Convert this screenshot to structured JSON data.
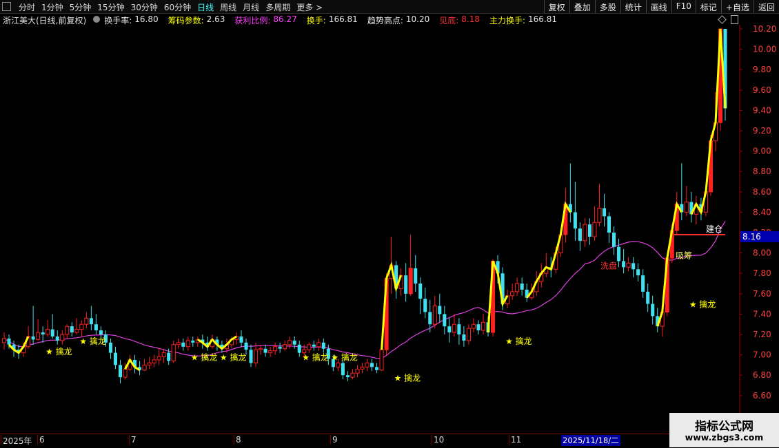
{
  "toolbar": {
    "periods": [
      "分时",
      "1分钟",
      "5分钟",
      "15分钟",
      "30分钟",
      "60分钟",
      "日线",
      "周线",
      "月线",
      "多周期",
      "更多 >"
    ],
    "active_period": "日线",
    "buttons": [
      "复权",
      "叠加",
      "多股",
      "统计",
      "画线",
      "F10",
      "标记",
      "+自选",
      "返回"
    ]
  },
  "info": {
    "title": "浙江美大(日线,前复权)",
    "turnover_label": "换手率:",
    "turnover_value": "16.80",
    "chip_label": "筹码参数:",
    "chip_value": "2.63",
    "profit_label": "获利比例:",
    "profit_value": "86.27",
    "hs_label": "换手:",
    "hs_value": "166.81",
    "trend_label": "趋势高点:",
    "trend_value": "10.20",
    "bottom_label": "见底:",
    "bottom_value": "8.18",
    "main_label": "主力换手:",
    "main_value": "166.81"
  },
  "axis": {
    "price_labels": [
      "10.20",
      "10.00",
      "9.80",
      "9.60",
      "9.40",
      "9.20",
      "9.00",
      "8.80",
      "8.60",
      "8.40",
      "8.20",
      "8.00",
      "7.80",
      "7.60",
      "7.40",
      "7.20",
      "7.00",
      "6.80",
      "6.60"
    ],
    "current_price": "8.16"
  },
  "dates": {
    "ticks": [
      "2025年",
      "6",
      "7",
      "8",
      "9",
      "10",
      "11"
    ],
    "cursor": "2025/11/18/二"
  },
  "signals": {
    "star_label": "★ 擒龙",
    "build": "建仓",
    "absorb": "吸筹",
    "wash": "洗盘"
  },
  "watermark": {
    "line1": "指标公式网",
    "line2": "www.zbgs3.com"
  },
  "colors": {
    "up": "#ff2020",
    "down": "#40e0f0",
    "ma": "#e040e0",
    "signal": "#ffff00"
  },
  "chart_data": {
    "type": "candlestick",
    "ylim": [
      6.5,
      10.3
    ],
    "candles": [
      [
        7.12,
        7.16,
        7.22,
        7.05
      ],
      [
        7.16,
        7.1,
        7.2,
        7.06
      ],
      [
        7.1,
        7.05,
        7.14,
        6.98
      ],
      [
        7.05,
        7.02,
        7.1,
        6.96
      ],
      [
        7.02,
        7.08,
        7.12,
        6.98
      ],
      [
        7.08,
        7.18,
        7.28,
        7.06
      ],
      [
        7.18,
        7.15,
        7.48,
        7.1
      ],
      [
        7.15,
        7.22,
        7.35,
        7.14
      ],
      [
        7.22,
        7.2,
        7.28,
        7.12
      ],
      [
        7.2,
        7.25,
        7.34,
        7.18
      ],
      [
        7.25,
        7.18,
        7.4,
        7.16
      ],
      [
        7.18,
        7.14,
        7.24,
        7.1
      ],
      [
        7.14,
        7.2,
        7.24,
        7.1
      ],
      [
        7.2,
        7.28,
        7.3,
        7.16
      ],
      [
        7.28,
        7.22,
        7.32,
        7.18
      ],
      [
        7.22,
        7.25,
        7.36,
        7.2
      ],
      [
        7.25,
        7.3,
        7.34,
        7.18
      ],
      [
        7.3,
        7.36,
        7.42,
        7.26
      ],
      [
        7.36,
        7.3,
        7.48,
        7.24
      ],
      [
        7.3,
        7.24,
        7.4,
        7.2
      ],
      [
        7.24,
        7.2,
        7.28,
        7.16
      ],
      [
        7.2,
        7.12,
        7.24,
        7.08
      ],
      [
        7.12,
        7.02,
        7.16,
        6.96
      ],
      [
        7.02,
        6.9,
        7.08,
        6.86
      ],
      [
        6.9,
        6.78,
        6.95,
        6.72
      ],
      [
        6.78,
        6.86,
        6.92,
        6.76
      ],
      [
        6.86,
        6.95,
        7.0,
        6.84
      ],
      [
        6.95,
        6.88,
        7.0,
        6.82
      ],
      [
        6.88,
        6.85,
        6.94,
        6.8
      ],
      [
        6.85,
        6.9,
        6.96,
        6.84
      ],
      [
        6.9,
        6.92,
        6.98,
        6.86
      ],
      [
        6.92,
        6.95,
        7.0,
        6.88
      ],
      [
        6.95,
        6.98,
        7.06,
        6.9
      ],
      [
        6.98,
        7.02,
        7.06,
        6.92
      ],
      [
        7.02,
        6.94,
        7.06,
        6.9
      ],
      [
        6.94,
        7.1,
        7.14,
        6.92
      ],
      [
        7.1,
        7.12,
        7.16,
        7.06
      ],
      [
        7.12,
        7.08,
        7.16,
        7.04
      ],
      [
        7.08,
        7.14,
        7.18,
        7.04
      ],
      [
        7.14,
        7.12,
        7.18,
        7.08
      ],
      [
        7.12,
        7.15,
        7.18,
        7.08
      ],
      [
        7.15,
        7.12,
        7.2,
        7.06
      ],
      [
        7.12,
        7.08,
        7.18,
        7.04
      ],
      [
        7.08,
        7.15,
        7.2,
        7.06
      ],
      [
        7.15,
        7.1,
        7.18,
        7.04
      ],
      [
        7.1,
        7.06,
        7.14,
        7.02
      ],
      [
        7.06,
        7.1,
        7.16,
        7.02
      ],
      [
        7.1,
        7.15,
        7.18,
        7.06
      ],
      [
        7.15,
        7.18,
        7.22,
        7.1
      ],
      [
        7.18,
        7.12,
        7.24,
        7.08
      ],
      [
        7.12,
        7.05,
        7.16,
        7.0
      ],
      [
        7.05,
        6.92,
        7.1,
        6.88
      ],
      [
        6.92,
        7.05,
        7.12,
        6.88
      ],
      [
        7.05,
        7.06,
        7.1,
        7.0
      ],
      [
        7.06,
        7.02,
        7.1,
        6.98
      ],
      [
        7.02,
        7.04,
        7.08,
        6.98
      ],
      [
        7.04,
        7.08,
        7.12,
        7.0
      ],
      [
        7.08,
        7.06,
        7.12,
        7.02
      ],
      [
        7.06,
        7.1,
        7.14,
        7.04
      ],
      [
        7.1,
        7.14,
        7.18,
        7.06
      ],
      [
        7.14,
        7.1,
        7.18,
        7.06
      ],
      [
        7.1,
        7.02,
        7.14,
        6.98
      ],
      [
        7.02,
        7.05,
        7.1,
        6.98
      ],
      [
        7.05,
        7.1,
        7.12,
        7.02
      ],
      [
        7.1,
        7.08,
        7.14,
        7.04
      ],
      [
        7.08,
        7.12,
        7.16,
        7.04
      ],
      [
        7.12,
        7.06,
        7.16,
        7.02
      ],
      [
        7.06,
        6.96,
        7.1,
        6.9
      ],
      [
        6.96,
        6.88,
        7.0,
        6.84
      ],
      [
        6.88,
        6.92,
        6.96,
        6.84
      ],
      [
        6.92,
        6.8,
        6.96,
        6.76
      ],
      [
        6.8,
        6.78,
        6.84,
        6.74
      ],
      [
        6.78,
        6.82,
        6.86,
        6.76
      ],
      [
        6.82,
        6.86,
        6.9,
        6.78
      ],
      [
        6.86,
        6.88,
        6.92,
        6.82
      ],
      [
        6.88,
        6.92,
        6.96,
        6.84
      ],
      [
        6.92,
        6.88,
        6.96,
        6.84
      ],
      [
        6.88,
        6.85,
        6.92,
        6.82
      ],
      [
        6.85,
        7.05,
        7.08,
        6.84
      ],
      [
        7.05,
        7.75,
        7.8,
        7.0
      ],
      [
        7.75,
        7.88,
        8.16,
        7.6
      ],
      [
        7.88,
        7.65,
        7.92,
        7.55
      ],
      [
        7.65,
        7.78,
        7.85,
        7.58
      ],
      [
        7.78,
        7.6,
        7.9,
        7.52
      ],
      [
        7.6,
        7.85,
        8.18,
        7.58
      ],
      [
        7.85,
        7.7,
        7.98,
        7.62
      ],
      [
        7.7,
        7.55,
        7.76,
        7.4
      ],
      [
        7.55,
        7.42,
        7.66,
        7.36
      ],
      [
        7.42,
        7.3,
        7.54,
        7.22
      ],
      [
        7.3,
        7.48,
        7.58,
        7.26
      ],
      [
        7.48,
        7.4,
        7.6,
        7.32
      ],
      [
        7.4,
        7.28,
        7.48,
        7.2
      ],
      [
        7.28,
        7.22,
        7.36,
        7.12
      ],
      [
        7.22,
        7.3,
        7.4,
        7.18
      ],
      [
        7.3,
        7.2,
        7.36,
        7.1
      ],
      [
        7.2,
        7.14,
        7.28,
        7.08
      ],
      [
        7.14,
        7.26,
        7.3,
        7.1
      ],
      [
        7.26,
        7.3,
        7.36,
        7.22
      ],
      [
        7.3,
        7.24,
        7.34,
        7.2
      ],
      [
        7.24,
        7.32,
        7.4,
        7.2
      ],
      [
        7.32,
        7.22,
        7.38,
        7.18
      ],
      [
        7.22,
        7.92,
        7.94,
        7.18
      ],
      [
        7.92,
        7.8,
        7.98,
        7.7
      ],
      [
        7.8,
        7.5,
        7.86,
        7.44
      ],
      [
        7.5,
        7.58,
        7.64,
        7.46
      ],
      [
        7.58,
        7.62,
        7.7,
        7.54
      ],
      [
        7.62,
        7.7,
        7.76,
        7.58
      ],
      [
        7.7,
        7.64,
        7.76,
        7.58
      ],
      [
        7.64,
        7.56,
        7.7,
        7.52
      ],
      [
        7.56,
        7.62,
        7.7,
        7.54
      ],
      [
        7.62,
        7.72,
        7.82,
        7.58
      ],
      [
        7.72,
        7.8,
        7.9,
        7.66
      ],
      [
        7.8,
        7.86,
        8.0,
        7.76
      ],
      [
        7.86,
        7.84,
        7.96,
        7.76
      ],
      [
        7.84,
        8.0,
        8.06,
        7.8
      ],
      [
        8.0,
        8.18,
        8.22,
        7.96
      ],
      [
        8.18,
        8.48,
        8.64,
        8.1
      ],
      [
        8.48,
        8.4,
        8.88,
        8.3
      ],
      [
        8.4,
        8.24,
        8.7,
        8.12
      ],
      [
        8.24,
        8.12,
        8.3,
        8.02
      ],
      [
        8.12,
        8.28,
        8.34,
        8.06
      ],
      [
        8.28,
        8.16,
        8.34,
        8.08
      ],
      [
        8.16,
        8.3,
        8.46,
        8.12
      ],
      [
        8.3,
        8.44,
        8.68,
        8.26
      ],
      [
        8.44,
        8.36,
        8.58,
        8.26
      ],
      [
        8.36,
        8.2,
        8.4,
        8.1
      ],
      [
        8.2,
        8.06,
        8.26,
        7.98
      ],
      [
        8.06,
        7.92,
        8.14,
        7.86
      ],
      [
        7.92,
        7.86,
        8.04,
        7.8
      ],
      [
        7.86,
        7.9,
        7.96,
        7.82
      ],
      [
        7.9,
        7.84,
        7.96,
        7.76
      ],
      [
        7.84,
        7.78,
        7.9,
        7.72
      ],
      [
        7.78,
        7.62,
        7.84,
        7.56
      ],
      [
        7.62,
        7.5,
        7.7,
        7.42
      ],
      [
        7.5,
        7.38,
        7.58,
        7.3
      ],
      [
        7.38,
        7.28,
        7.46,
        7.22
      ],
      [
        7.28,
        7.42,
        7.48,
        7.18
      ],
      [
        7.42,
        7.95,
        7.98,
        7.38
      ],
      [
        7.95,
        8.22,
        8.28,
        7.9
      ],
      [
        8.22,
        8.48,
        8.6,
        8.18
      ],
      [
        8.48,
        8.4,
        8.88,
        8.32
      ],
      [
        8.4,
        8.5,
        8.66,
        8.36
      ],
      [
        8.5,
        8.38,
        8.6,
        8.3
      ],
      [
        8.38,
        8.48,
        8.56,
        8.28
      ],
      [
        8.48,
        8.4,
        8.54,
        8.32
      ],
      [
        8.4,
        8.6,
        8.66,
        8.36
      ],
      [
        8.6,
        9.1,
        9.16,
        8.56
      ],
      [
        9.1,
        9.28,
        9.58,
        9.0
      ],
      [
        9.28,
        10.2,
        10.2,
        9.2
      ],
      [
        10.2,
        9.42,
        10.2,
        9.3
      ]
    ],
    "signal_markers": [
      {
        "index": 8,
        "price": 7.1,
        "label": "★ 擒龙"
      },
      {
        "index": 15,
        "price": 7.2,
        "label": "★ 擒龙"
      },
      {
        "index": 38,
        "price": 7.04,
        "label": "★ 擒龙"
      },
      {
        "index": 44,
        "price": 7.04,
        "label": "★ 擒龙"
      },
      {
        "index": 61,
        "price": 7.04,
        "label": "★ 擒龙"
      },
      {
        "index": 67,
        "price": 7.04,
        "label": "★ 擒龙"
      },
      {
        "index": 80,
        "price": 6.84,
        "label": "★ 擒龙"
      },
      {
        "index": 103,
        "price": 7.2,
        "label": "★ 擒龙"
      },
      {
        "index": 141,
        "price": 7.56,
        "label": "★ 擒龙"
      }
    ],
    "current_price": 8.16,
    "build_level": 8.18
  }
}
